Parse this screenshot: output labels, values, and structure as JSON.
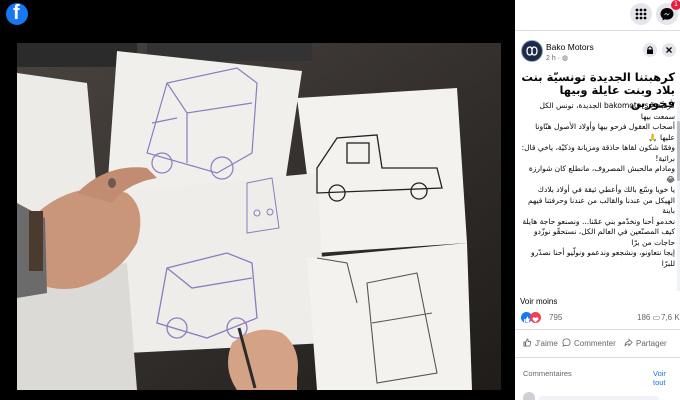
{
  "page": {
    "name": "Bako Motors",
    "time": "2 h",
    "title": "كرهبتنا الجديدة تونسيّة بنت بلاد وبنت عايلة وبيها فخورين",
    "body_lines": [
      "كرهبة #bakomotors الجديدة، تونس الكل سمعت بيها",
      "أصحاب العقول فرحو بيها وأولاد الأصول هنّاونا عليها 🙏",
      "وفمّا شكون لقاها حاذقة ومزيانة وذكيّة، ياخي قال: برائية!",
      "ومادام مالحبش المصروف، مانطلع كان شوارزة 😂",
      "يا خويا وسّع بالك وأعطي ثيقة في أولاد بلادك",
      "الهيكل من عندنا والقالب من عندنا وحرفتنا فيهم باينة",
      "نخدمو أحنا ونخدّمو بني عمّنا... ونصنعو حاجة هايلة",
      "كيف المصنّعين في العالم الكل، نستحقّو نوزّدو حاجات من برّا",
      "إيجا نتعاونو، ونشجعو وندعمو ونولّيو أحنا نصدّرو للبرّا"
    ],
    "see_more": "Voir moins",
    "reactions_count": "795",
    "comments_count": "186",
    "shares_count": "7,6 K",
    "actions": {
      "like": "J'aime",
      "comment": "Commenter",
      "share": "Partager"
    },
    "comments_label": "Commentaires",
    "see_all": "Voir tout",
    "notification_count": "1"
  },
  "icons": {
    "app_logo": "facebook-logo-icon",
    "menu": "grid-menu-icon",
    "messenger": "messenger-icon",
    "lock": "lock-icon",
    "close": "close-icon"
  },
  "colors": {
    "facebook_blue": "#1877f2",
    "like_blue": "#1877f2",
    "love_red": "#f33e58",
    "link_blue": "#216fdb"
  }
}
